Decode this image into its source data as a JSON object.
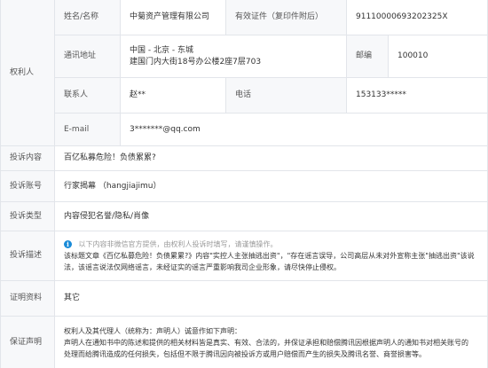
{
  "rights_holder": {
    "section_label": "权利人",
    "name_label": "姓名/名称",
    "name_value": "中菊资产管理有限公司",
    "cert_label": "有效证件（复印件附后）",
    "cert_value": "91110000693202325X",
    "address_label": "通讯地址",
    "address_line1": "中国 - 北京 - 东城",
    "address_line2": "建国门内大街18号办公楼2座7层703",
    "postcode_label": "邮编",
    "postcode_value": "100010",
    "contact_label": "联系人",
    "contact_value": "赵**",
    "phone_label": "电话",
    "phone_value": "153133*****",
    "email_label": "E-mail",
    "email_value": "3*******@qq.com"
  },
  "complaint_content": {
    "label": "投诉内容",
    "value": "百亿私募危险！负债累累?"
  },
  "complaint_account": {
    "label": "投诉账号",
    "value": "行家揭幕 （hangjiajimu）"
  },
  "complaint_type": {
    "label": "投诉类型",
    "value": "内容侵犯名誉/隐私/肖像"
  },
  "complaint_desc": {
    "label": "投诉描述",
    "hint": "以下内容非微信官方提供，由权利人投诉时填写，请谨慎操作。",
    "line1": "该标题文章《百亿私募危险！负债累累?》内容\"实控人主张抽逃出资\"，\"存在谣言误导，公司高层从未对外宣称主张\"抽逃出资\"该说",
    "line2": "法，该谣言说法仅网络谣言，未经证实的谣言严重影响我司企业形象，请尽快停止侵权。"
  },
  "evidence": {
    "label": "证明资料",
    "value": "其它"
  },
  "guarantee": {
    "label": "保证声明",
    "line1": "权利人及其代理人（统称为：声明人）诚意作如下声明：",
    "line2": "声明人在通知书中的陈述和提供的相关材料皆是真实、有效、合法的，并保证承担和赔偿腾讯因根据声明人的通知书对相关账号的",
    "line3": "处理而给腾讯造成的任何损失，包括但不限于腾讯因向被投诉方或用户赔偿而产生的损失及腾讯名誉、商誉损害等。"
  },
  "icons": {
    "info": "info-circle-icon"
  },
  "colors": {
    "label_bg": "#f7f8fa",
    "border": "#e2e5ea",
    "hint_icon": "#1a8bd8"
  }
}
